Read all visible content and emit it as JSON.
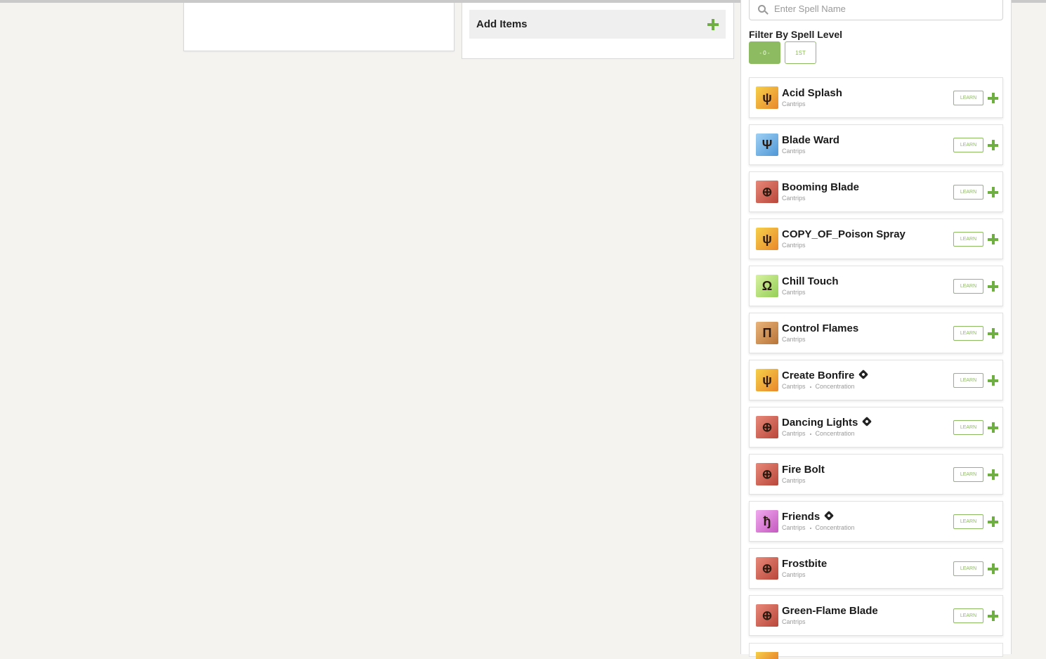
{
  "main": {
    "add_items_label": "Add Items"
  },
  "sidebar": {
    "search_placeholder": "Enter Spell Name",
    "filter_title": "Filter By Spell Level",
    "levels": [
      "- 0 -",
      "1ST"
    ],
    "learn_label": "LEARN",
    "spells": [
      {
        "name": "Acid Splash",
        "meta": "Cantrips",
        "concentration": false,
        "icon": "evocation-sigil",
        "icon_glyph": "ψ"
      },
      {
        "name": "Blade Ward",
        "meta": "Cantrips",
        "concentration": false,
        "icon": "abjuration-sigil",
        "icon_glyph": "Ψ"
      },
      {
        "name": "Booming Blade",
        "meta": "Cantrips",
        "concentration": false,
        "icon": "eye-sigil",
        "icon_glyph": "⊕"
      },
      {
        "name": "COPY_OF_Poison Spray",
        "meta": "Cantrips",
        "concentration": false,
        "icon": "evocation-sigil",
        "icon_glyph": "ψ"
      },
      {
        "name": "Chill Touch",
        "meta": "Cantrips",
        "concentration": false,
        "icon": "necromancy-sigil",
        "icon_glyph": "Ω"
      },
      {
        "name": "Control Flames",
        "meta": "Cantrips",
        "concentration": false,
        "icon": "transmutation-sigil",
        "icon_glyph": "Π"
      },
      {
        "name": "Create Bonfire",
        "meta": "Cantrips",
        "concentration": true,
        "meta2": "Concentration",
        "icon": "evocation-sigil",
        "icon_glyph": "ψ"
      },
      {
        "name": "Dancing Lights",
        "meta": "Cantrips",
        "concentration": true,
        "meta2": "Concentration",
        "icon": "eye-sigil",
        "icon_glyph": "⊕"
      },
      {
        "name": "Fire Bolt",
        "meta": "Cantrips",
        "concentration": false,
        "icon": "eye-sigil",
        "icon_glyph": "⊕"
      },
      {
        "name": "Friends",
        "meta": "Cantrips",
        "concentration": true,
        "meta2": "Concentration",
        "icon": "enchantment-sigil",
        "icon_glyph": "ђ"
      },
      {
        "name": "Frostbite",
        "meta": "Cantrips",
        "concentration": false,
        "icon": "eye-sigil",
        "icon_glyph": "⊕"
      },
      {
        "name": "Green-Flame Blade",
        "meta": "Cantrips",
        "concentration": false,
        "icon": "eye-sigil",
        "icon_glyph": "⊕"
      }
    ]
  },
  "colors": {
    "accent": "#8dbb62",
    "plus": "#6fae43",
    "background": "#f4f3ef"
  }
}
